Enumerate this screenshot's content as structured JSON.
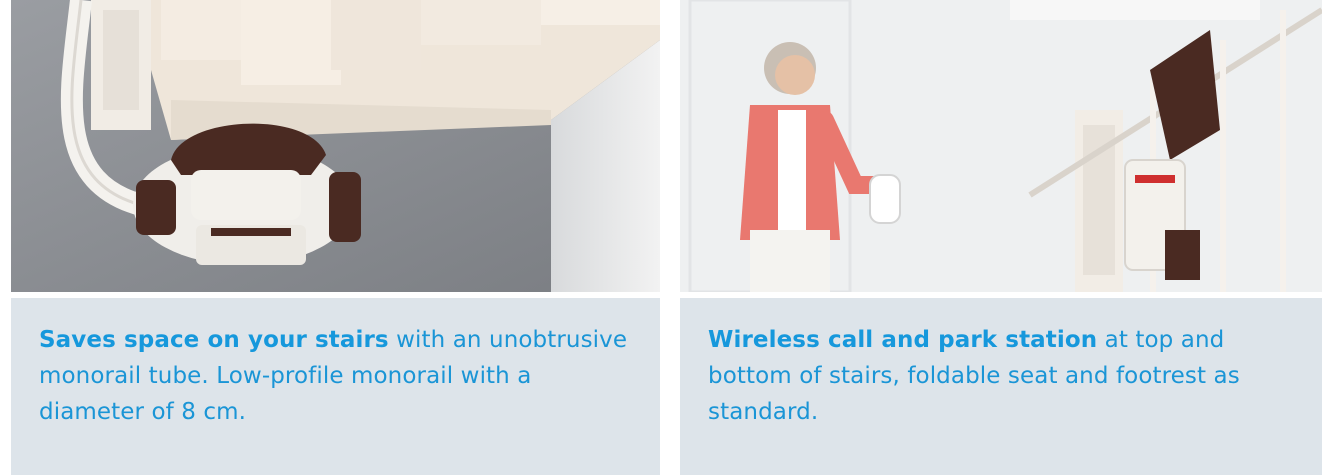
{
  "cards": [
    {
      "image_alt": "Stairlift seat with monorail tube seen from above",
      "caption_bold": "Saves space on your stairs",
      "caption_rest": " with an unobtrusive monorail tube. Low-profile monorail with a diameter of 8 cm."
    },
    {
      "image_alt": "Woman using wireless call and park station next to stairlift",
      "caption_bold": "Wireless call and park station",
      "caption_rest": " at top and bottom of stairs, foldable seat and footrest as standard."
    }
  ],
  "colors": {
    "caption_bg": "#dde4ea",
    "caption_text": "#1a95d6",
    "seat_brown": "#4a2a22",
    "cardigan": "#e9786f"
  }
}
